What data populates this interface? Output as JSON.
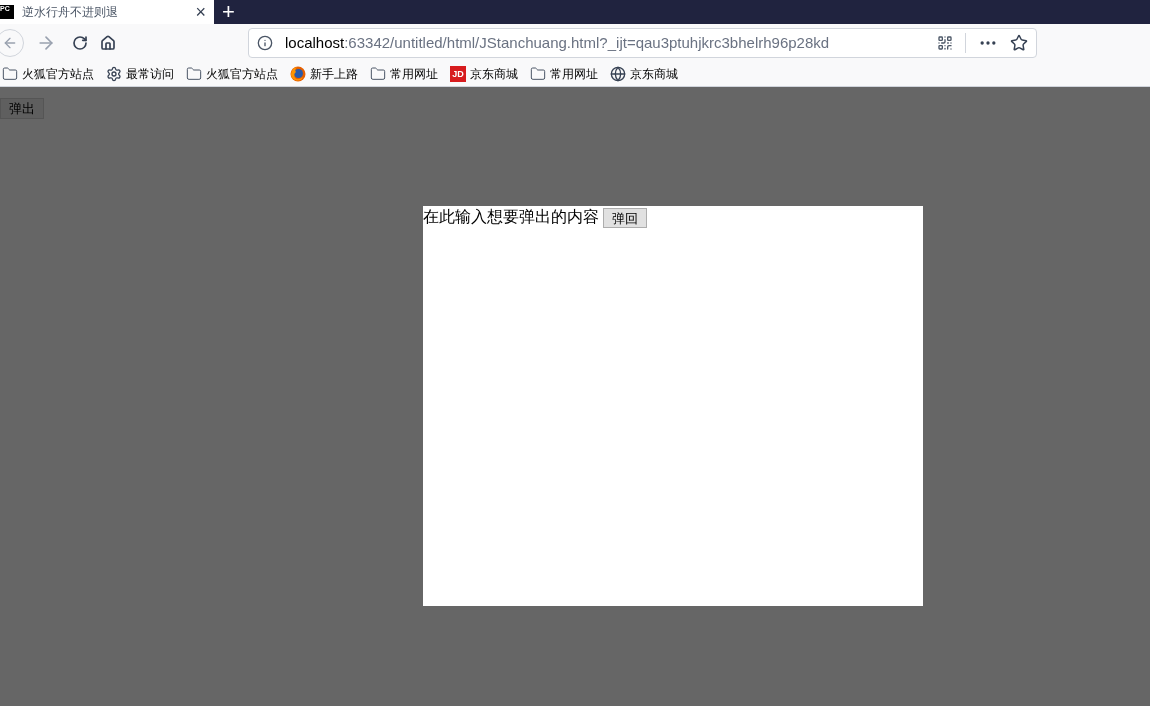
{
  "tab": {
    "favicon": "PC",
    "title": "逆水行舟不进则退",
    "selected": true,
    "close": "×"
  },
  "new_tab": "+",
  "address_bar": {
    "host": "localhost",
    "rest": ":63342/untitled/html/JStanchuang.html?_ijt=qau3ptuhjkrc3bhelrh96p28kd"
  },
  "bookmarks": [
    {
      "kind": "folder",
      "label": "火狐官方站点"
    },
    {
      "kind": "gear",
      "label": "最常访问"
    },
    {
      "kind": "folder",
      "label": "火狐官方站点"
    },
    {
      "kind": "firefox",
      "label": "新手上路"
    },
    {
      "kind": "folder",
      "label": "常用网址"
    },
    {
      "kind": "jd",
      "badge": "JD",
      "label": "京东商城"
    },
    {
      "kind": "folder",
      "label": "常用网址"
    },
    {
      "kind": "globe",
      "label": "京东商城"
    }
  ],
  "page": {
    "open_button": "弹出",
    "popup": {
      "text": "在此输入想要弹出的内容",
      "close_button": "弹回"
    }
  }
}
